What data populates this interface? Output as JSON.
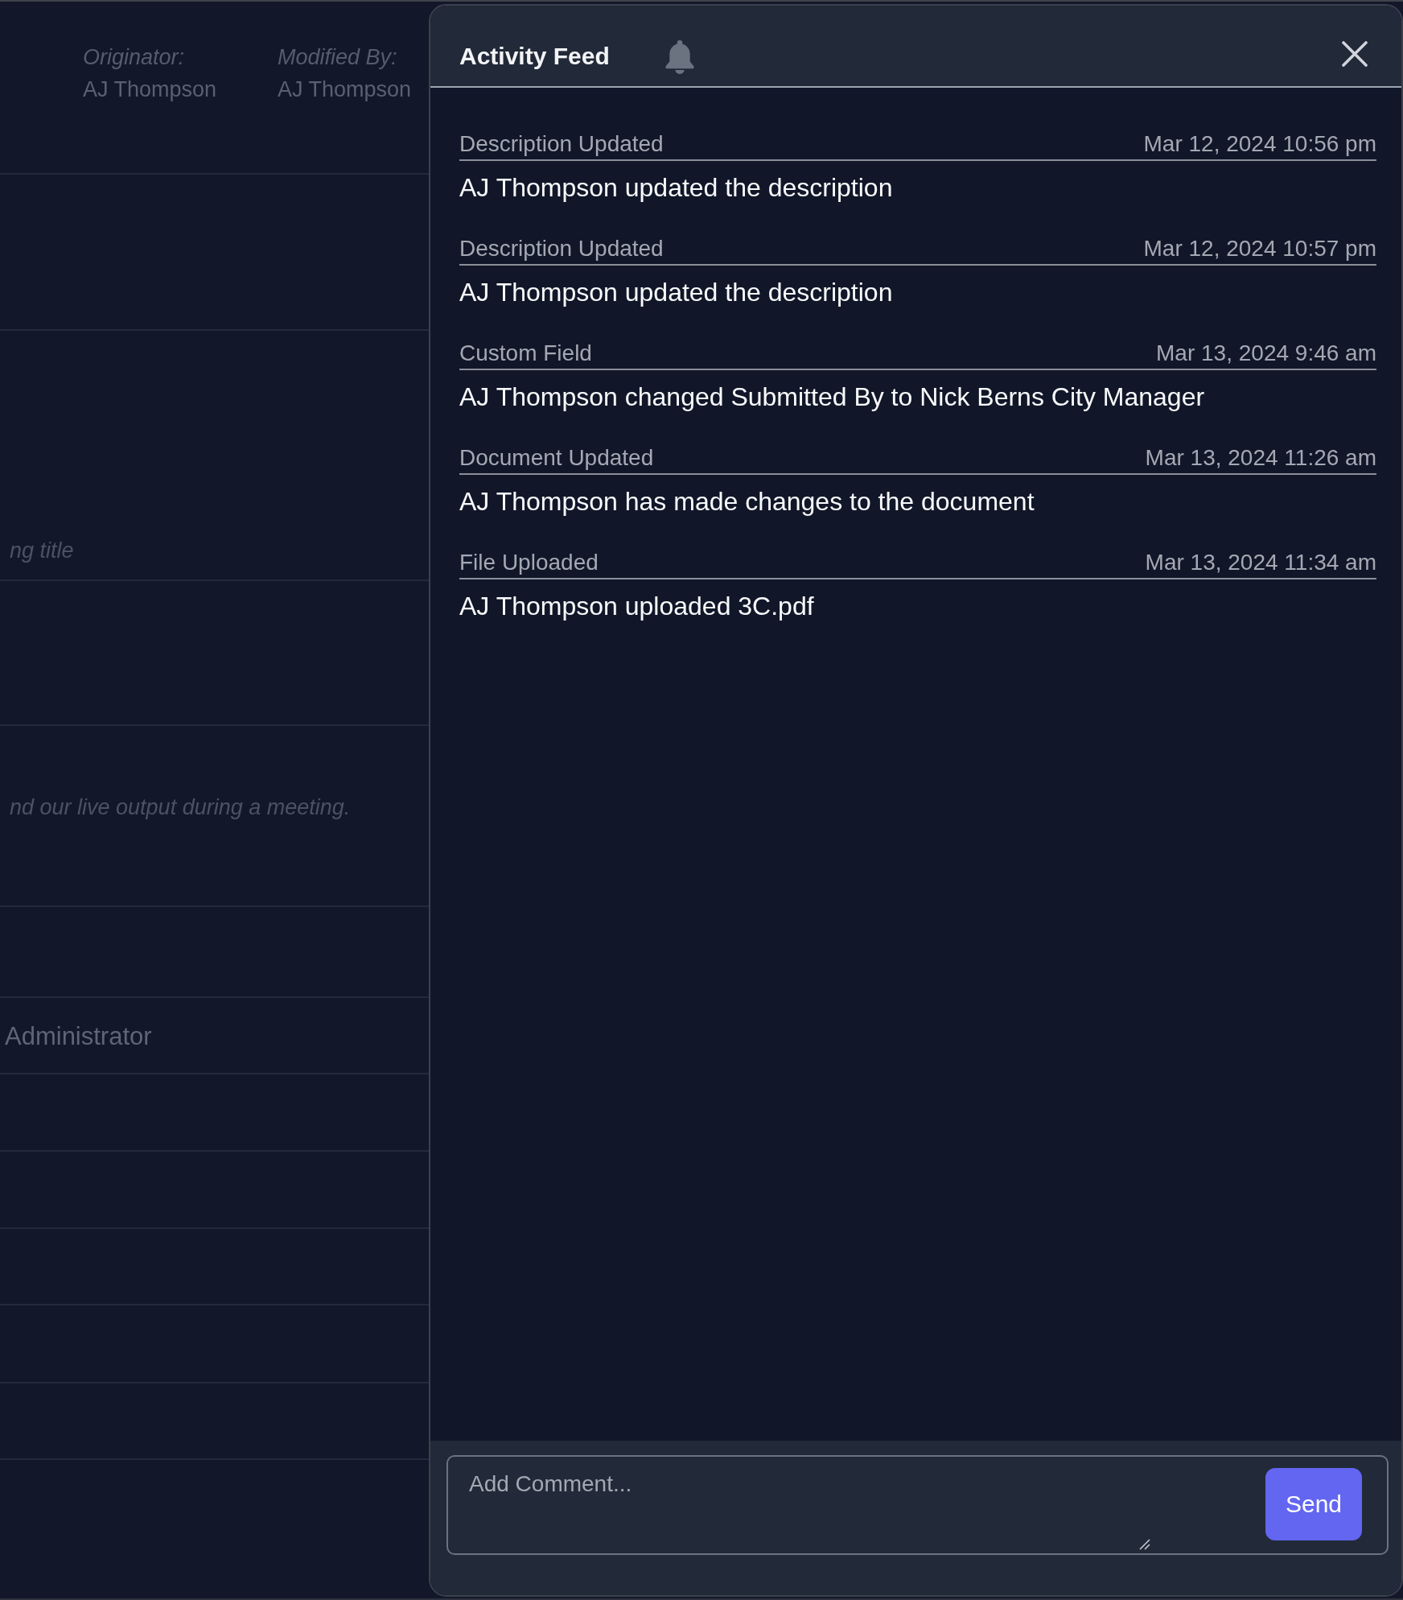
{
  "background_form": {
    "originator": {
      "label": "Originator:",
      "value": "AJ Thompson"
    },
    "modified_by": {
      "label": "Modified By:",
      "value": "AJ Thompson"
    },
    "rows": [
      {
        "kind": "blank"
      },
      {
        "kind": "field",
        "placeholder": "ng title"
      },
      {
        "kind": "blank"
      },
      {
        "kind": "field",
        "placeholder": "nd our live output during a meeting."
      },
      {
        "kind": "blank"
      },
      {
        "kind": "value",
        "text": "Administrator"
      },
      {
        "kind": "blank"
      },
      {
        "kind": "blank"
      },
      {
        "kind": "blank"
      },
      {
        "kind": "blank"
      },
      {
        "kind": "blank"
      }
    ]
  },
  "activity_feed": {
    "title": "Activity Feed",
    "entries": [
      {
        "type": "Description Updated",
        "time": "Mar 12, 2024 10:56 pm",
        "message": "AJ Thompson updated the description"
      },
      {
        "type": "Description Updated",
        "time": "Mar 12, 2024 10:57 pm",
        "message": "AJ Thompson updated the description"
      },
      {
        "type": "Custom Field",
        "time": "Mar 13, 2024 9:46 am",
        "message": "AJ Thompson changed Submitted By to Nick Berns City Manager"
      },
      {
        "type": "Document Updated",
        "time": "Mar 13, 2024 11:26 am",
        "message": "AJ Thompson has made changes to the document"
      },
      {
        "type": "File Uploaded",
        "time": "Mar 13, 2024 11:34 am",
        "message": "AJ Thompson uploaded 3C.pdf"
      }
    ],
    "comment": {
      "placeholder": "Add Comment..."
    },
    "send_button": "Send"
  }
}
